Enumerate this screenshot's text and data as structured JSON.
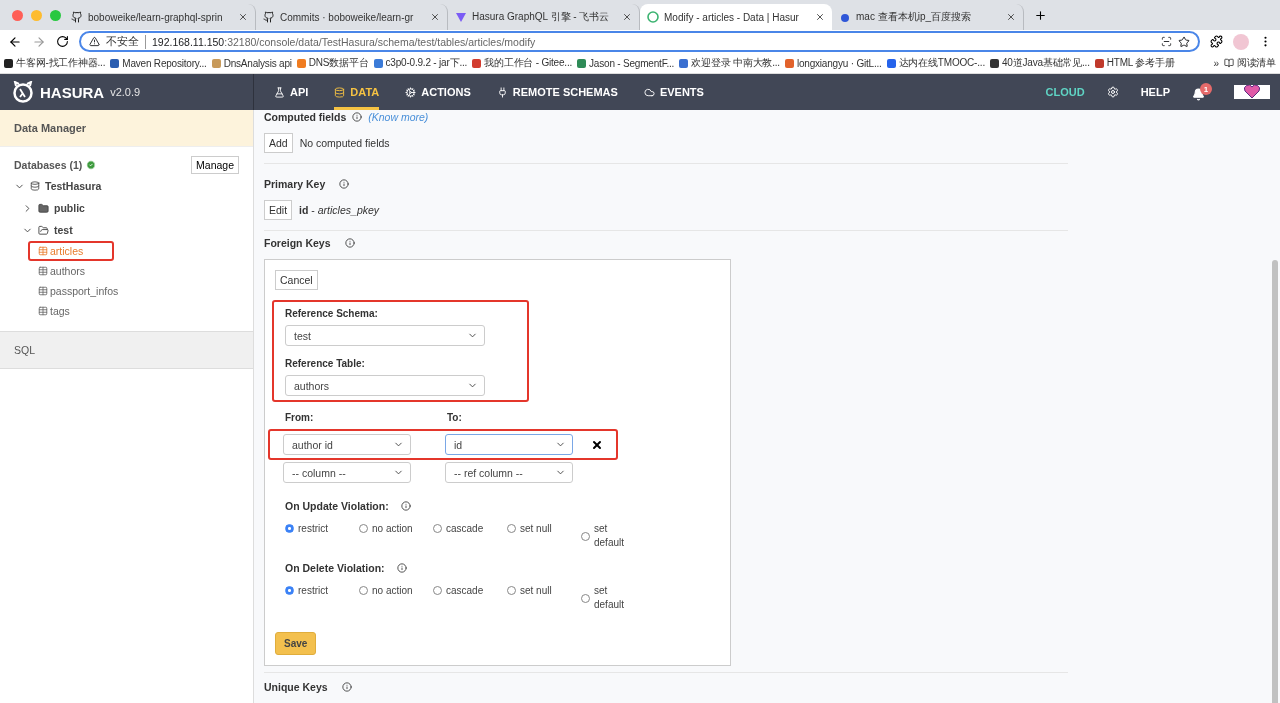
{
  "browser": {
    "tabs": [
      {
        "title": "boboweike/learn-graphql-sprin",
        "selected": false
      },
      {
        "title": "Commits · boboweike/learn-gr",
        "selected": false
      },
      {
        "title": "Hasura GraphQL 引擎 - 飞书云",
        "selected": false
      },
      {
        "title": "Modify - articles - Data | Hasur",
        "selected": true
      },
      {
        "title": "mac 查看本机ip_百度搜索",
        "selected": false
      }
    ],
    "address": {
      "security": "不安全",
      "host": "192.168.11.150",
      "path": ":32180/console/data/TestHasura/schema/test/tables/articles/modify"
    },
    "bookmarks": [
      "牛客网-找工作神器...",
      "Maven Repository...",
      "DnsAnalysis api",
      "DNS数据平台",
      "c3p0-0.9.2 - jar下...",
      "我的工作台 - Gitee...",
      "Jason - SegmentF...",
      "欢迎登录 中南大教...",
      "longxiangyu · GitL...",
      "达内在线TMOOC-...",
      "40道Java基础常见...",
      "HTML 参考手册"
    ],
    "bookmarks_overflow": "»",
    "reading_list": "阅读清单"
  },
  "header": {
    "brand": "HASURA",
    "version": "v2.0.9",
    "nav": [
      {
        "label": "API",
        "selected": false
      },
      {
        "label": "DATA",
        "selected": true
      },
      {
        "label": "ACTIONS",
        "selected": false
      },
      {
        "label": "REMOTE SCHEMAS",
        "selected": false
      },
      {
        "label": "EVENTS",
        "selected": false
      }
    ],
    "cloud": "CLOUD",
    "help": "HELP",
    "notifications": "1"
  },
  "sidebar": {
    "title": "Data Manager",
    "databases": "Databases (1)",
    "manage": "Manage",
    "tree": [
      {
        "label": "TestHasura",
        "expanded": true,
        "children": [
          {
            "label": "public",
            "expanded": false
          },
          {
            "label": "test",
            "expanded": true,
            "children": [
              {
                "label": "articles",
                "selected": true,
                "annotated": true
              },
              {
                "label": "authors",
                "selected": false,
                "annotated": false
              },
              {
                "label": "passport_infos",
                "selected": false,
                "annotated": false
              },
              {
                "label": "tags",
                "selected": false,
                "annotated": false
              }
            ]
          }
        ]
      }
    ],
    "sql": "SQL"
  },
  "computed_fields": {
    "title": "Computed fields",
    "link": "(Know more)",
    "add": "Add",
    "empty": "No computed fields"
  },
  "primary_key": {
    "title": "Primary Key",
    "edit": "Edit",
    "value": "**id** - *articles_pkey*"
  },
  "foreign_keys": {
    "title": "Foreign Keys",
    "cancel": "Cancel",
    "reference_annotated": true,
    "reference_schema": {
      "label": "Reference Schema:",
      "value": "test"
    },
    "reference_table": {
      "label": "Reference Table:",
      "value": "authors"
    },
    "from_label": "From:",
    "to_label": "To:",
    "mappings": [
      {
        "from": "author id",
        "to": "id",
        "focused": true,
        "removable": true,
        "annotated": true
      },
      {
        "from": "-- column --",
        "to": "-- ref column --",
        "focused": false,
        "removable": false,
        "annotated": false
      }
    ],
    "violations": [
      {
        "label": "On Update Violation:",
        "options": [
          {
            "label": "restrict",
            "selected": true
          },
          {
            "label": "no action",
            "selected": false
          },
          {
            "label": "cascade",
            "selected": false
          },
          {
            "label": "set null",
            "selected": false
          },
          {
            "label": "set default",
            "selected": false
          }
        ]
      },
      {
        "label": "On Delete Violation:",
        "options": [
          {
            "label": "restrict",
            "selected": true
          },
          {
            "label": "no action",
            "selected": false
          },
          {
            "label": "cascade",
            "selected": false
          },
          {
            "label": "set null",
            "selected": false
          },
          {
            "label": "set default",
            "selected": false
          }
        ]
      }
    ],
    "save": "Save"
  },
  "unique_keys": {
    "title": "Unique Keys"
  }
}
